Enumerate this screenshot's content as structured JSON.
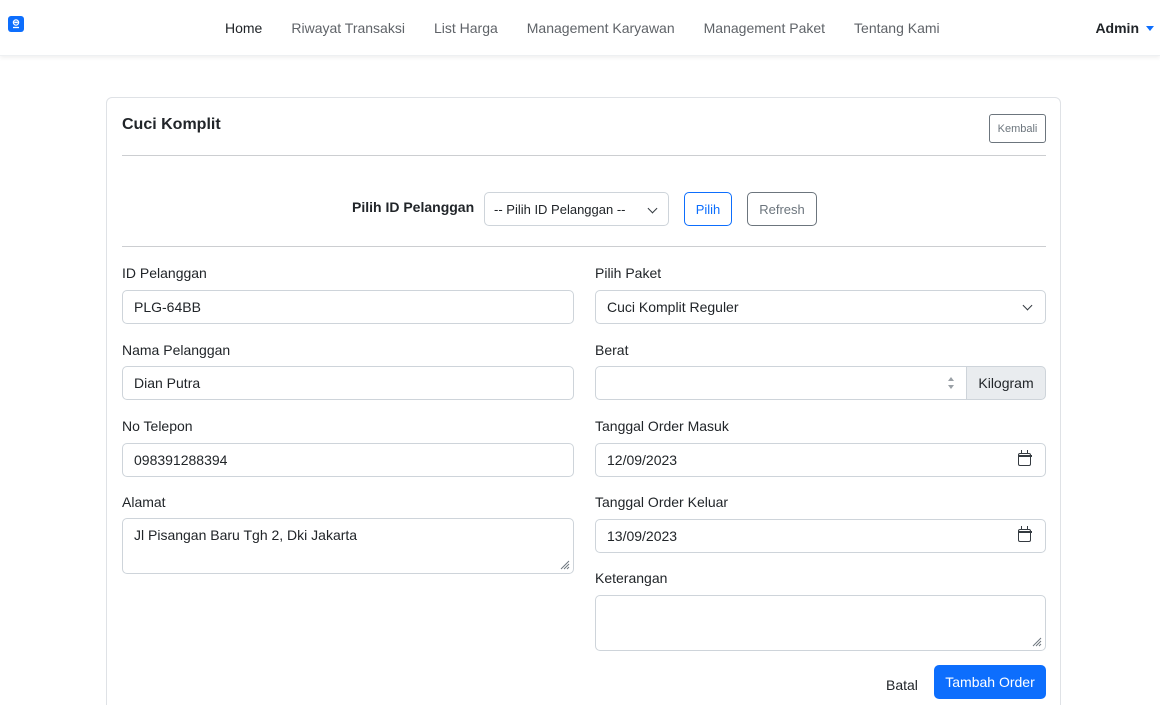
{
  "nav": {
    "links": [
      "Home",
      "Riwayat Transaksi",
      "List Harga",
      "Management Karyawan",
      "Management Paket",
      "Tentang Kami"
    ],
    "user": "Admin"
  },
  "card": {
    "title": "Cuci Komplit",
    "back_label": "Kembali"
  },
  "lookup": {
    "label": "Pilih ID Pelanggan",
    "select_value": "-- Pilih ID Pelanggan --",
    "pick_label": "Pilih",
    "refresh_label": "Refresh"
  },
  "form": {
    "id_pelanggan": {
      "label": "ID Pelanggan",
      "value": "PLG-64BB"
    },
    "nama_pelanggan": {
      "label": "Nama Pelanggan",
      "value": "Dian Putra"
    },
    "no_telepon": {
      "label": "No Telepon",
      "value": "098391288394"
    },
    "alamat": {
      "label": "Alamat",
      "value": "Jl Pisangan Baru Tgh 2, Dki Jakarta"
    },
    "paket": {
      "label": "Pilih Paket",
      "value": "Cuci Komplit Reguler"
    },
    "berat": {
      "label": "Berat",
      "value": "",
      "unit": "Kilogram"
    },
    "tanggal_masuk": {
      "label": "Tanggal Order Masuk",
      "value": "12/09/2023"
    },
    "tanggal_keluar": {
      "label": "Tanggal Order Keluar",
      "value": "13/09/2023"
    },
    "keterangan": {
      "label": "Keterangan",
      "value": ""
    }
  },
  "actions": {
    "cancel_label": "Batal",
    "submit_label": "Tambah Order"
  },
  "colors": {
    "primary": "#0d6efd",
    "secondary": "#6c757d",
    "addon_bg": "#e9ecef"
  }
}
